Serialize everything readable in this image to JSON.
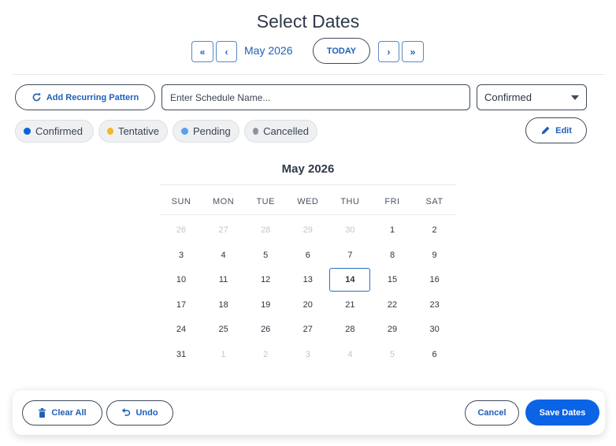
{
  "header": {
    "title": "Select Dates"
  },
  "nav": {
    "first_label": "«",
    "prev_label": "‹",
    "current_label": "May 2026",
    "today_label": "TODAY",
    "next_label": "›",
    "last_label": "»"
  },
  "toolbar": {
    "recurring_label": "Add Recurring Pattern",
    "recurring_icon": "refresh-icon",
    "schedule_name": {
      "value": "",
      "placeholder": "Enter Schedule Name..."
    },
    "status_select": {
      "selected": "Confirmed"
    },
    "edit_label": "Edit",
    "edit_icon": "pencil-icon"
  },
  "legend": [
    {
      "label": "Confirmed",
      "color": "#0b63d8"
    },
    {
      "label": "Tentative",
      "color": "#f5b622"
    },
    {
      "label": "Pending",
      "color": "#5aa0ee"
    },
    {
      "label": "Cancelled",
      "color": "#8d939c"
    }
  ],
  "calendar": {
    "month_title": "May 2026",
    "weekdays": [
      "SUN",
      "MON",
      "TUE",
      "WED",
      "THU",
      "FRI",
      "SAT"
    ],
    "weeks": [
      [
        {
          "d": "26",
          "m": true
        },
        {
          "d": "27",
          "m": true
        },
        {
          "d": "28",
          "m": true
        },
        {
          "d": "29",
          "m": true
        },
        {
          "d": "30",
          "m": true
        },
        {
          "d": "1"
        },
        {
          "d": "2"
        }
      ],
      [
        {
          "d": "3"
        },
        {
          "d": "4"
        },
        {
          "d": "5"
        },
        {
          "d": "6"
        },
        {
          "d": "7"
        },
        {
          "d": "8"
        },
        {
          "d": "9"
        }
      ],
      [
        {
          "d": "10"
        },
        {
          "d": "11"
        },
        {
          "d": "12"
        },
        {
          "d": "13"
        },
        {
          "d": "14",
          "sel": true
        },
        {
          "d": "15"
        },
        {
          "d": "16"
        }
      ],
      [
        {
          "d": "17"
        },
        {
          "d": "18"
        },
        {
          "d": "19"
        },
        {
          "d": "20"
        },
        {
          "d": "21"
        },
        {
          "d": "22"
        },
        {
          "d": "23"
        }
      ],
      [
        {
          "d": "24"
        },
        {
          "d": "25"
        },
        {
          "d": "26"
        },
        {
          "d": "27"
        },
        {
          "d": "28"
        },
        {
          "d": "29"
        },
        {
          "d": "30"
        }
      ],
      [
        {
          "d": "31"
        },
        {
          "d": "1",
          "m": true
        },
        {
          "d": "2",
          "m": true
        },
        {
          "d": "3",
          "m": true
        },
        {
          "d": "4",
          "m": true
        },
        {
          "d": "5",
          "m": true
        },
        {
          "d": "6"
        }
      ]
    ]
  },
  "footer": {
    "clear_label": "Clear All",
    "clear_icon": "trash-icon",
    "undo_label": "Undo",
    "undo_icon": "undo-icon",
    "cancel_label": "Cancel",
    "save_label": "Save Dates",
    "accent": "#0b63e5"
  }
}
